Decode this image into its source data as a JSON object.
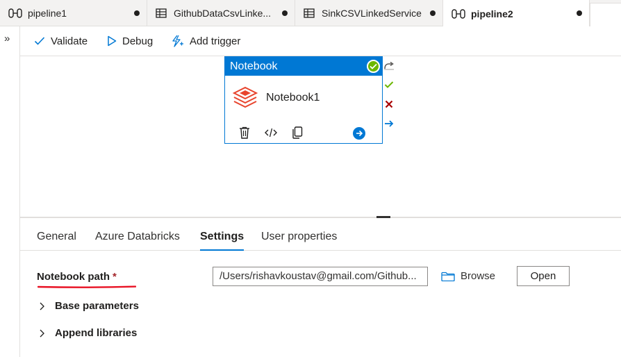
{
  "tabs": [
    {
      "label": "pipeline1",
      "icon": "pipeline-icon",
      "unsaved": false,
      "active": false
    },
    {
      "label": "GithubDataCsvLinke...",
      "icon": "table-icon",
      "unsaved": true,
      "active": false
    },
    {
      "label": "SinkCSVLinkedService",
      "icon": "table-icon",
      "unsaved": true,
      "active": false
    },
    {
      "label": "pipeline2",
      "icon": "pipeline-icon",
      "unsaved": true,
      "active": true
    }
  ],
  "rail": {
    "expand_label": "»"
  },
  "toolbar": {
    "validate_label": "Validate",
    "debug_label": "Debug",
    "add_trigger_label": "Add trigger"
  },
  "activity": {
    "type_label": "Notebook",
    "name": "Notebook1",
    "status": "succeeded",
    "colors": {
      "header": "#0078d4",
      "success": "#6bb700",
      "failure": "#a80000",
      "databricks": "#e8442d"
    }
  },
  "properties": {
    "tabs": [
      "General",
      "Azure Databricks",
      "Settings",
      "User properties"
    ],
    "active_tab": "Settings",
    "notebook_path_label": "Notebook path",
    "required_marker": "*",
    "notebook_path_value": "/Users/rishavkoustav@gmail.com/Github...",
    "browse_label": "Browse",
    "open_label": "Open",
    "base_parameters_label": "Base parameters",
    "append_libraries_label": "Append libraries"
  }
}
